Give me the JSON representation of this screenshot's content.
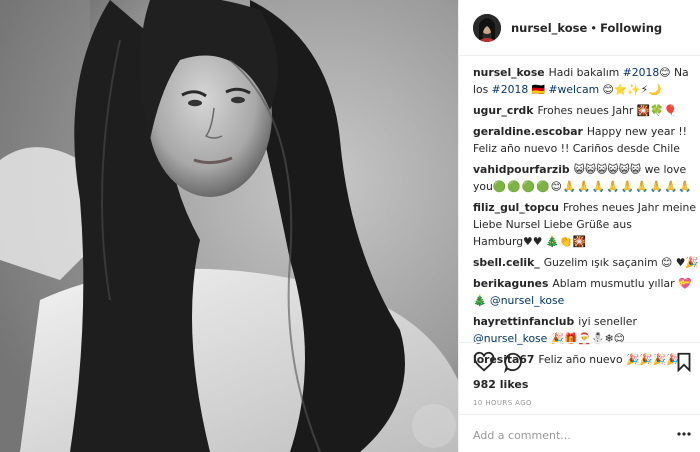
{
  "header": {
    "username": "nursel_kose",
    "separator": "•",
    "follow_label": "Following"
  },
  "comments": [
    {
      "user": "nursel_kose",
      "parts": [
        {
          "t": "Hadi bakalım "
        },
        {
          "t": "#2018",
          "tag": true
        },
        {
          "t": "😊 Na los "
        },
        {
          "t": "#2018",
          "tag": true
        },
        {
          "t": " 🇩🇪 "
        },
        {
          "t": "#welcam",
          "tag": true
        },
        {
          "t": " 😊⭐✨⚡🌙"
        }
      ]
    },
    {
      "user": "ugur_crdk",
      "parts": [
        {
          "t": "Frohes neues Jahr 🎇🍀🎈"
        }
      ]
    },
    {
      "user": "geraldine.escobar",
      "parts": [
        {
          "t": "Happy new year !! Feliz año nuevo !! Cariños desde Chile"
        }
      ]
    },
    {
      "user": "vahidpourfarzib",
      "parts": [
        {
          "t": "😺😺😺😺😺😺 we love you"
        },
        {
          "t": "🟢🟢🟢🟢😊🙏🙏🙏🙏🙏🙏🙏🙏🙏",
          "emo": true
        }
      ]
    },
    {
      "user": "filiz_gul_topcu",
      "parts": [
        {
          "t": "Frohes neues Jahr meine Liebe Nursel Liebe Grüße aus Hamburg♥♥ 🎄👏🎇"
        }
      ]
    },
    {
      "user": "sbell.celik_",
      "parts": [
        {
          "t": "Guzelim ışık saçanim 😊 ♥🎉"
        }
      ]
    },
    {
      "user": "berikagunes",
      "parts": [
        {
          "t": "Ablam musmutlu yıllar 💝 "
        },
        {
          "t": "🎄 "
        },
        {
          "t": "@nursel_kose",
          "tag": true
        }
      ]
    },
    {
      "user": "hayrettinfanclub",
      "parts": [
        {
          "t": "iyi seneller "
        },
        {
          "t": "@nursel_kose",
          "tag": true
        },
        {
          "t": " 🎉🎁🎅⛄❄😊"
        }
      ]
    },
    {
      "user": "loresita67",
      "parts": [
        {
          "t": "Feliz año nuevo 🎉🎉🎉🎉"
        }
      ]
    }
  ],
  "likes": "982 likes",
  "time": "10 HOURS AGO",
  "add_comment": {
    "placeholder": "Add a comment..."
  }
}
